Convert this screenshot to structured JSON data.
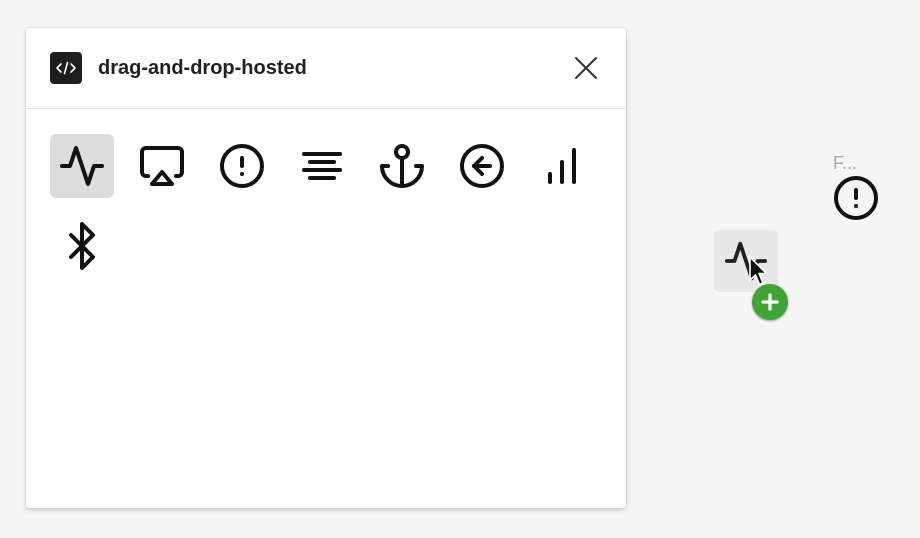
{
  "panel": {
    "title": "drag-and-drop-hosted",
    "plugin_icon": "code-brackets-icon",
    "close_icon": "close-icon"
  },
  "icons": [
    {
      "name": "activity-icon",
      "selected": true
    },
    {
      "name": "airplay-icon",
      "selected": false
    },
    {
      "name": "alert-circle-icon",
      "selected": false
    },
    {
      "name": "align-center-icon",
      "selected": false
    },
    {
      "name": "anchor-icon",
      "selected": false
    },
    {
      "name": "arrow-left-circle-icon",
      "selected": false
    },
    {
      "name": "bar-chart-icon",
      "selected": false
    },
    {
      "name": "bluetooth-icon",
      "selected": false
    }
  ],
  "canvas_node": {
    "label": "F...",
    "icon": "alert-circle-icon"
  },
  "drag": {
    "ghost_icon": "activity-icon",
    "drop_indicator": "plus-icon",
    "drop_color": "#3fa336"
  },
  "colors": {
    "background": "#f5f5f5",
    "panel": "#ffffff",
    "selected_tile": "#dcdcdc",
    "badge": "#1e1e1e"
  }
}
